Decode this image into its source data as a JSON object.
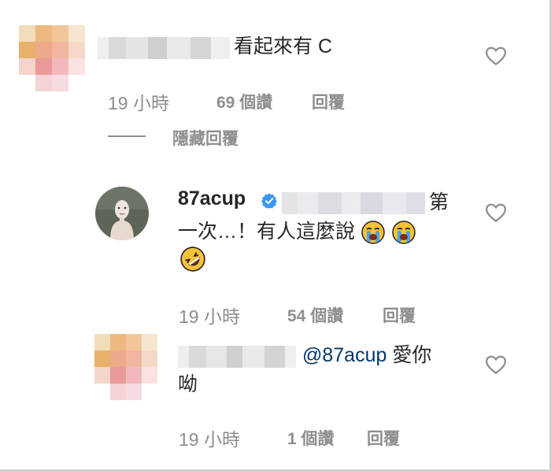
{
  "comments": [
    {
      "text": "看起來有 C",
      "time": "19 小時",
      "likes": "69 個讚",
      "reply": "回覆",
      "hide_replies": "隱藏回覆"
    },
    {
      "username": "87acup",
      "text_line1": "第",
      "text_line2": "一次…！有人這麼說",
      "time": "19 小時",
      "likes": "54 個讚",
      "reply": "回覆"
    },
    {
      "mention": "@87acup",
      "text_after_mention": " 愛你",
      "text_line2": "呦",
      "time": "19 小時",
      "likes": "1 個讚",
      "reply": "回覆"
    }
  ],
  "colors": {
    "text": "#262626",
    "muted": "#8e8e8e",
    "mention": "#00376b",
    "verified": "#3897f0"
  },
  "icons": [
    "heart-icon",
    "verified-badge-icon",
    "loudly-crying-face-icon",
    "rolling-on-floor-laughing-icon"
  ]
}
